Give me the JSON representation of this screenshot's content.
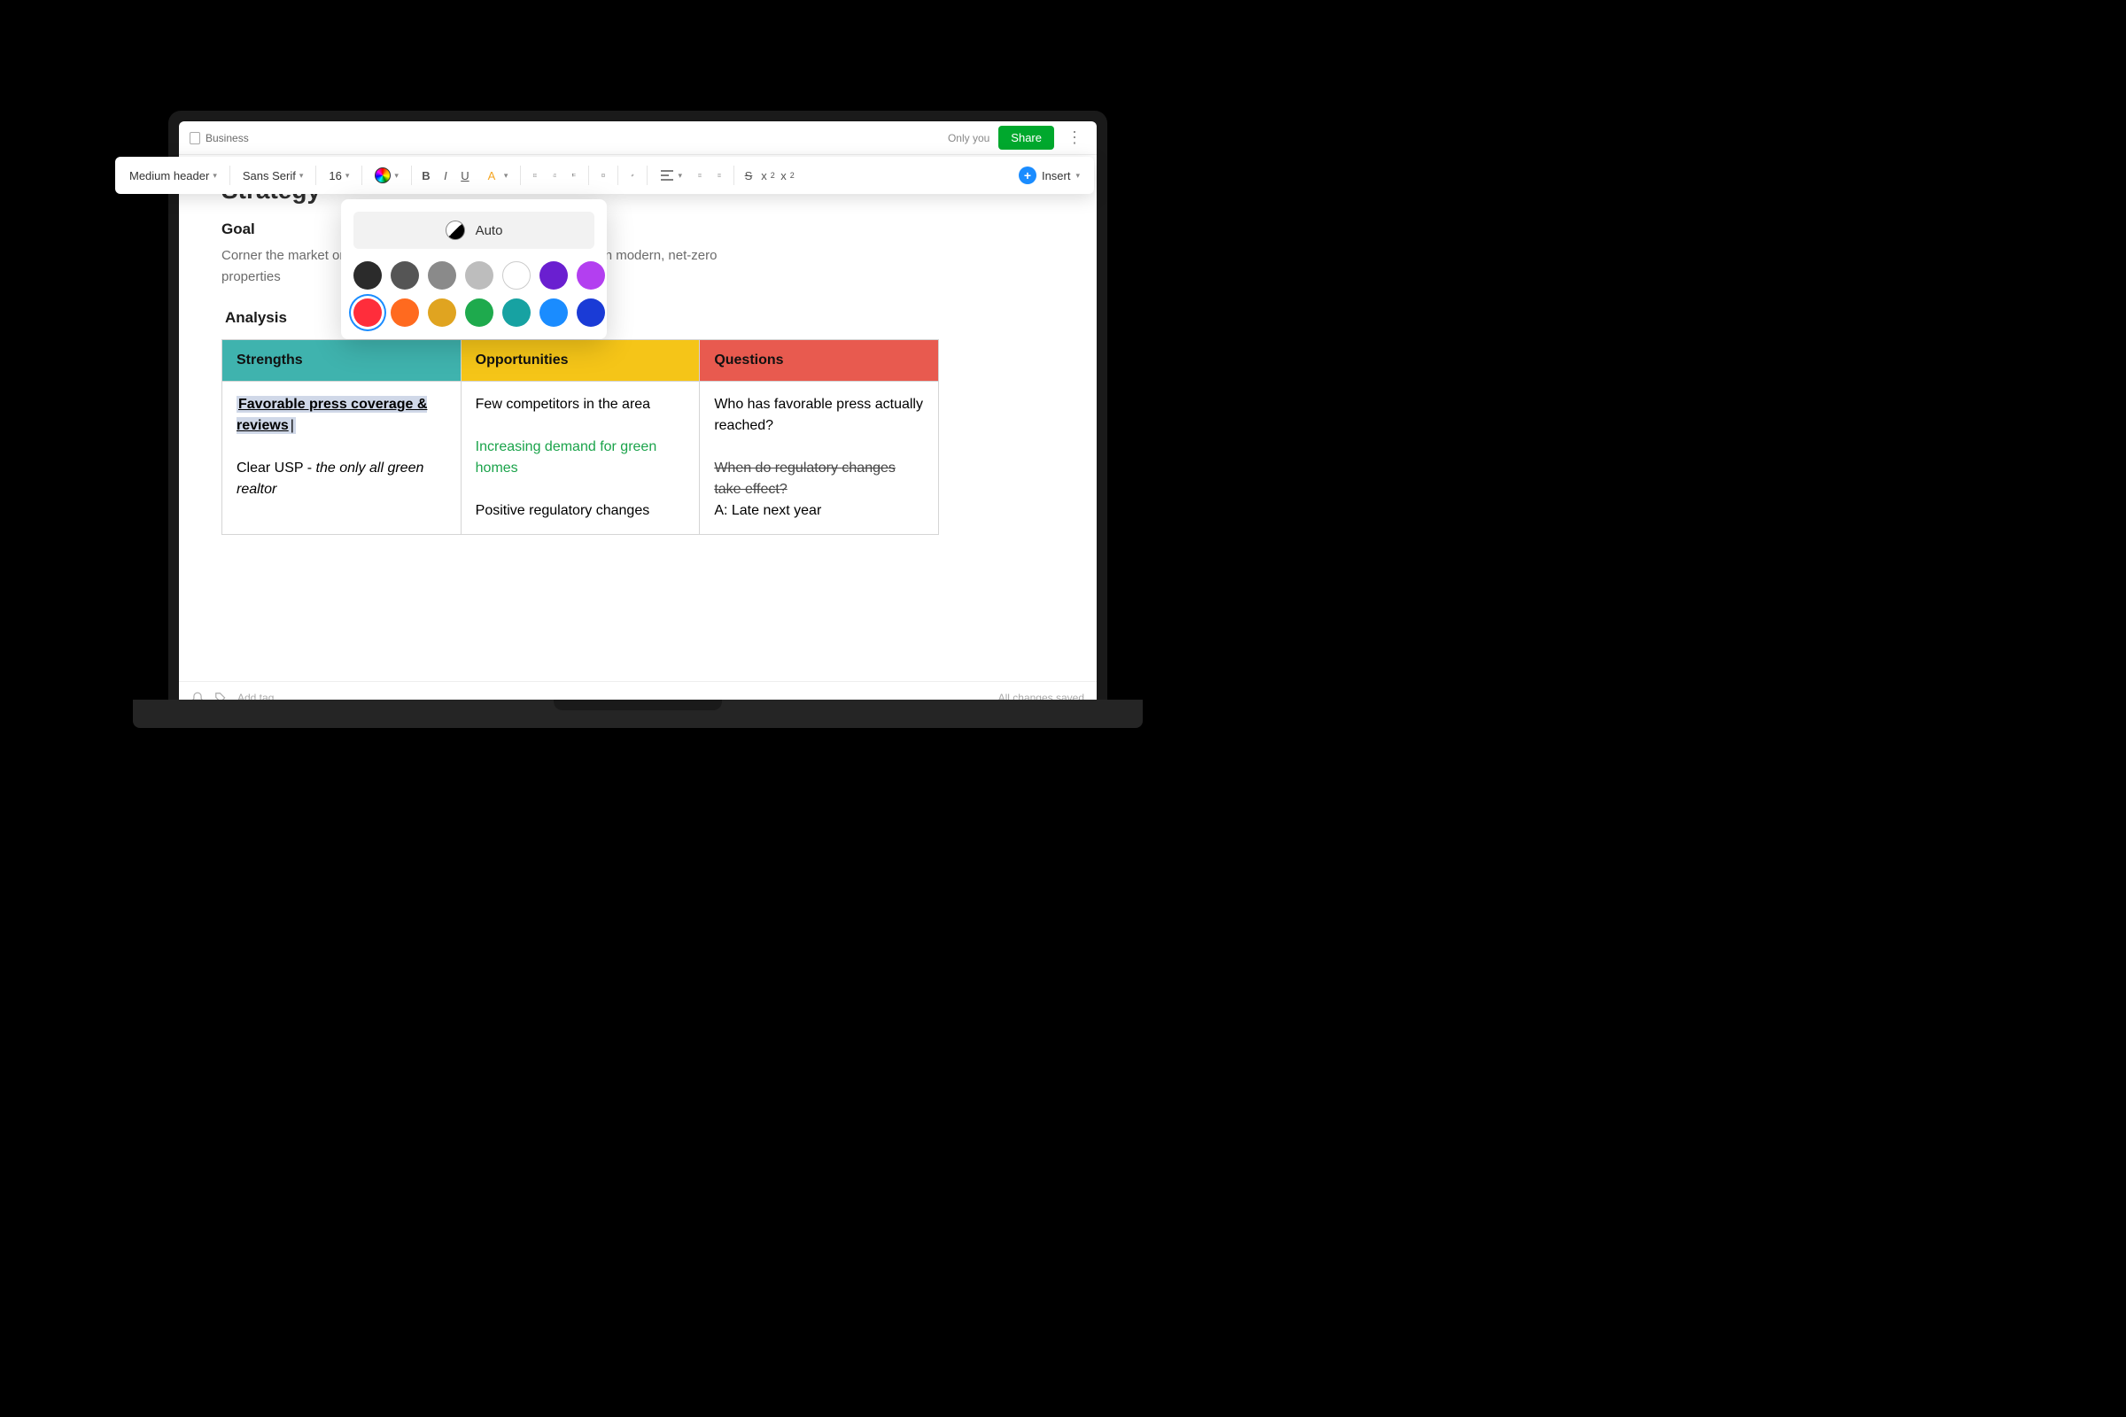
{
  "breadcrumb": {
    "label": "Business"
  },
  "share": {
    "only_you": "Only you",
    "button": "Share"
  },
  "toolbar": {
    "style": "Medium header",
    "font": "Sans Serif",
    "size": "16",
    "insert": "Insert"
  },
  "doc": {
    "title": "Strategy",
    "goal_heading": "Goal",
    "goal_text": "Corner the market on residential property listings by specializing in modern, net-zero properties",
    "analysis_heading": "Analysis"
  },
  "table": {
    "headers": {
      "strengths": "Strengths",
      "opportunities": "Opportunities",
      "questions": "Questions"
    },
    "strengths": {
      "fav_press": "Favorable press coverage & reviews",
      "usp_prefix": "Clear USP - ",
      "usp_italic": "the only all green realtor"
    },
    "opportunities": {
      "line1": "Few competitors in the area",
      "line2": "Increasing demand for green homes",
      "line3": "Positive regulatory changes"
    },
    "questions": {
      "q1": "Who has favorable press actually reached?",
      "q2": "When do regulatory changes take effect?",
      "a2": "A: Late next year"
    }
  },
  "color_picker": {
    "auto_label": "Auto",
    "colors_row1": [
      "#2b2b2b",
      "#555555",
      "#8a8a8a",
      "#bdbdbd",
      "#ffffff",
      "#6a1fd0",
      "#b33ff0"
    ],
    "colors_row2": [
      "#ff2d3b",
      "#ff6a1f",
      "#e0a420",
      "#1eaa4d",
      "#17a2a2",
      "#1a8cff",
      "#1a3bd6"
    ],
    "selected": "#ff2d3b"
  },
  "footer": {
    "add_tag": "Add tag",
    "saved": "All changes saved"
  }
}
